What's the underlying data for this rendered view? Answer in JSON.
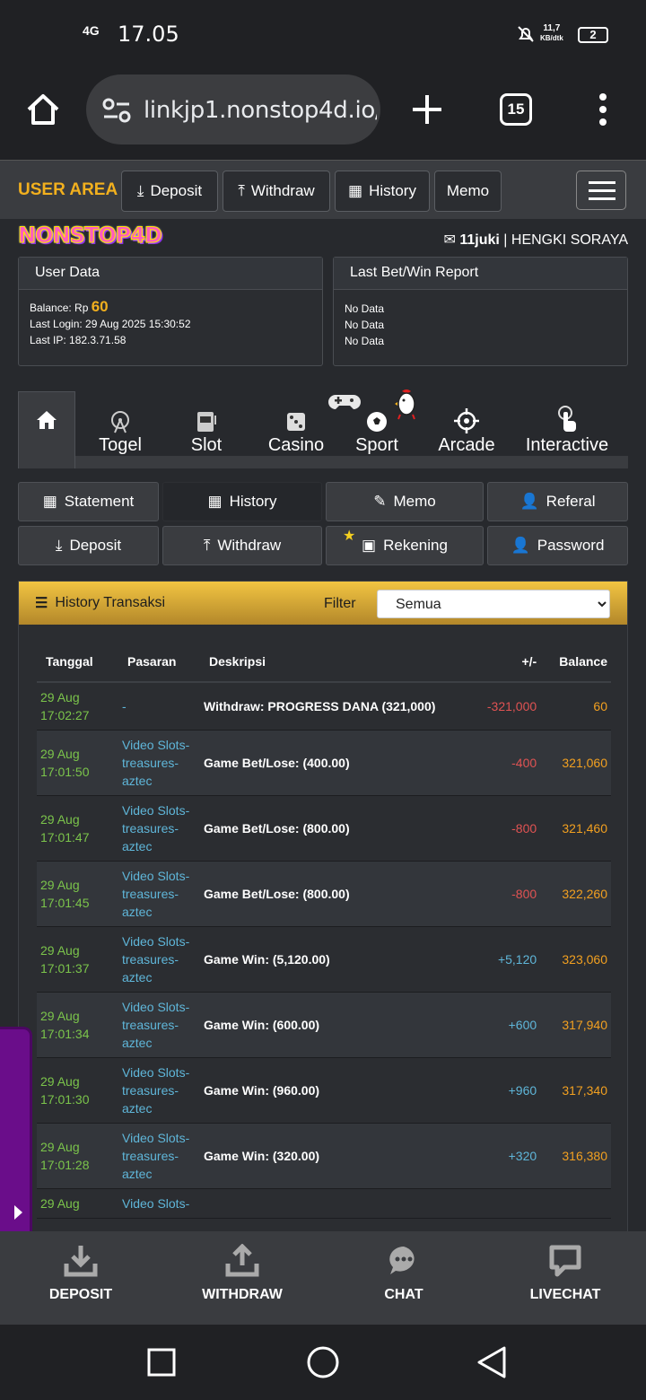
{
  "status": {
    "network": "4G",
    "time": "17.05",
    "speed_value": "11,7",
    "speed_unit": "KB/dtk",
    "battery": "2"
  },
  "browser": {
    "url": "linkjp1.nonstop4d.io/",
    "tab_count": "15"
  },
  "topnav": {
    "user_area": "USER AREA",
    "buttons": [
      "Deposit",
      "Withdraw",
      "History",
      "Memo"
    ]
  },
  "brand": {
    "logo": "NONSTOP4D",
    "user_id": "11juki",
    "user_name": "| HENGKI SORAYA"
  },
  "user_data": {
    "title": "User Data",
    "balance_label": "Balance: Rp",
    "balance_value": "60",
    "last_login": "Last Login: 29 Aug 2025 15:30:52",
    "last_ip": "Last IP: 182.3.71.58"
  },
  "last_bet": {
    "title": "Last Bet/Win Report",
    "rows": [
      "No Data",
      "No Data",
      "No Data"
    ]
  },
  "game_tabs": [
    "Togel",
    "Slot",
    "Casino",
    "Sport",
    "Arcade",
    "Interactive"
  ],
  "sub_menu": [
    "Statement",
    "History",
    "Memo",
    "Referal",
    "Deposit",
    "Withdraw",
    "Rekening",
    "Password"
  ],
  "history": {
    "title": "History Transaksi",
    "filter_label": "Filter",
    "filter_value": "Semua",
    "columns": [
      "Tanggal",
      "Pasaran",
      "Deskripsi",
      "+/-",
      "Balance"
    ],
    "rows": [
      {
        "date": "29 Aug",
        "time": "17:02:27",
        "pasaran": "-",
        "desc": "Withdraw: PROGRESS DANA (321,000)",
        "amount": "-321,000",
        "balance": "60",
        "sign": "neg"
      },
      {
        "date": "29 Aug",
        "time": "17:01:50",
        "pasaran": "Video Slots-treasures-aztec",
        "desc": "Game Bet/Lose: (400.00)",
        "amount": "-400",
        "balance": "321,060",
        "sign": "neg"
      },
      {
        "date": "29 Aug",
        "time": "17:01:47",
        "pasaran": "Video Slots-treasures-aztec",
        "desc": "Game Bet/Lose: (800.00)",
        "amount": "-800",
        "balance": "321,460",
        "sign": "neg"
      },
      {
        "date": "29 Aug",
        "time": "17:01:45",
        "pasaran": "Video Slots-treasures-aztec",
        "desc": "Game Bet/Lose: (800.00)",
        "amount": "-800",
        "balance": "322,260",
        "sign": "neg"
      },
      {
        "date": "29 Aug",
        "time": "17:01:37",
        "pasaran": "Video Slots-treasures-aztec",
        "desc": "Game Win: (5,120.00)",
        "amount": "+5,120",
        "balance": "323,060",
        "sign": "pos"
      },
      {
        "date": "29 Aug",
        "time": "17:01:34",
        "pasaran": "Video Slots-treasures-aztec",
        "desc": "Game Win: (600.00)",
        "amount": "+600",
        "balance": "317,940",
        "sign": "pos"
      },
      {
        "date": "29 Aug",
        "time": "17:01:30",
        "pasaran": "Video Slots-treasures-aztec",
        "desc": "Game Win: (960.00)",
        "amount": "+960",
        "balance": "317,340",
        "sign": "pos"
      },
      {
        "date": "29 Aug",
        "time": "17:01:28",
        "pasaran": "Video Slots-treasures-aztec",
        "desc": "Game Win: (320.00)",
        "amount": "+320",
        "balance": "316,380",
        "sign": "pos"
      },
      {
        "date": "29 Aug",
        "time": "",
        "pasaran": "Video Slots-",
        "desc": "",
        "amount": "",
        "balance": "",
        "sign": "pos"
      }
    ]
  },
  "bottom_bar": [
    "DEPOSIT",
    "WITHDRAW",
    "CHAT",
    "LIVECHAT"
  ],
  "colors": {
    "accent": "#f2b01e",
    "win": "#5fb6d9",
    "lose": "#e05353",
    "date": "#7bc44b",
    "balance": "#f2a020"
  }
}
